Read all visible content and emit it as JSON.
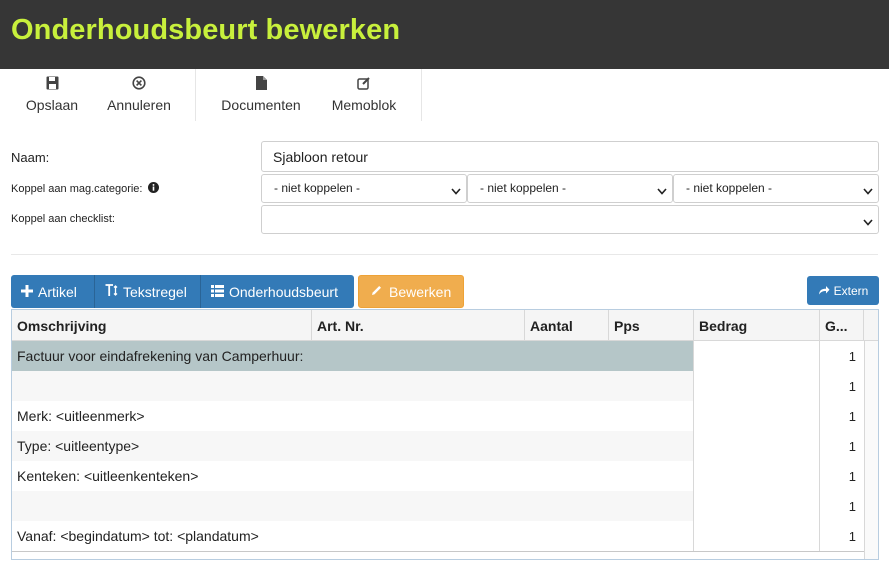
{
  "page": {
    "title": "Onderhoudsbeurt bewerken"
  },
  "toolbar": {
    "save": {
      "label": "Opslaan",
      "icon": "floppy-disk-icon"
    },
    "cancel": {
      "label": "Annuleren",
      "icon": "circle-x-icon"
    },
    "documents": {
      "label": "Documenten",
      "icon": "document-icon"
    },
    "memo": {
      "label": "Memoblok",
      "icon": "edit-icon"
    }
  },
  "form": {
    "naam_label": "Naam:",
    "naam_value": "Sjabloon retour",
    "koppel_cat_label": "Koppel aan mag.categorie:",
    "koppel_cat_options": [
      "- niet koppelen -",
      "- niet koppelen -",
      "- niet koppelen -"
    ],
    "koppel_check_label": "Koppel aan checklist:",
    "koppel_check_value": ""
  },
  "actions": {
    "artikel": "Artikel",
    "tekstregel": "Tekstregel",
    "onderhoudsbeurt": "Onderhoudsbeurt",
    "bewerken": "Bewerken",
    "extern": "Extern"
  },
  "grid": {
    "columns": [
      "Omschrijving",
      "Art. Nr.",
      "Aantal",
      "Pps",
      "Bedrag",
      "G..."
    ],
    "rows": [
      {
        "omschrijving": "Factuur voor eindafrekening van Camperhuur:",
        "g": "1",
        "selected": true
      },
      {
        "omschrijving": "",
        "g": "1"
      },
      {
        "omschrijving": "Merk: <uitleenmerk>",
        "g": "1"
      },
      {
        "omschrijving": "Type: <uitleentype>",
        "g": "1"
      },
      {
        "omschrijving": "Kenteken: <uitleenkenteken>",
        "g": "1"
      },
      {
        "omschrijving": "",
        "g": "1"
      },
      {
        "omschrijving": "Vanaf: <begindatum> tot: <plandatum>",
        "g": "1"
      }
    ]
  },
  "colors": {
    "titlebar_bg": "#363636",
    "title_fg": "#c8f03c",
    "primary": "#337ab7",
    "warning": "#f0ad4e",
    "selected_row": "#b5c6c8"
  }
}
